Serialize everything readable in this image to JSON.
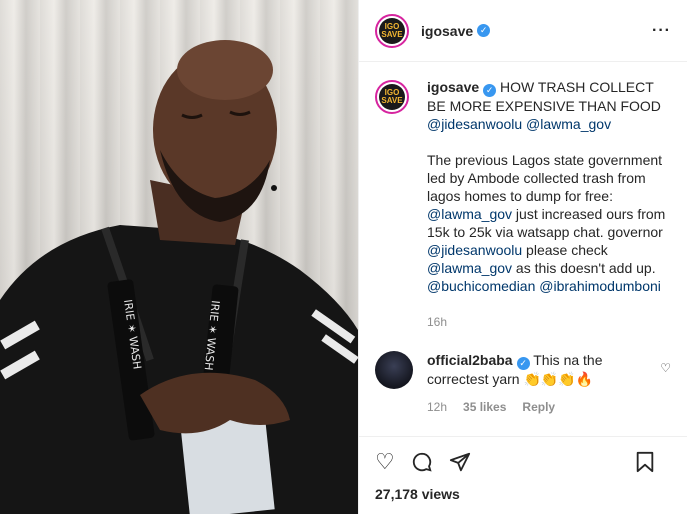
{
  "post": {
    "username": "igosave",
    "avatar_text": "IGO SAVE",
    "caption_title": "HOW TRASH COLLECT BE MORE EXPENSIVE THAN FOOD",
    "caption_mentions": "@jidesanwoolu @lawma_gov",
    "caption_p2_a": "The previous Lagos state government led by Ambode collected trash from lagos homes to dump for free: ",
    "caption_p2_link1": "@lawma_gov",
    "caption_p2_b": " just increased ours from 15k to 25k via watsapp chat. governor ",
    "caption_p2_link2": "@jidesanwoolu",
    "caption_p2_c": " please check ",
    "caption_p2_link3": "@lawma_gov",
    "caption_p2_d": " as this doesn't add up. ",
    "caption_p2_link4": "@buchicomedian",
    "caption_p2_space": " ",
    "caption_p2_link5": "@ibrahimodumboni",
    "time": "16h",
    "views": "27,178 views"
  },
  "comment": {
    "username": "official2baba",
    "text": "This na the correctest yarn 👏👏👏🔥",
    "time": "12h",
    "likes": "35 likes",
    "reply": "Reply"
  },
  "icons": {
    "more": "more-icon",
    "verified": "verified-icon",
    "like": "heart-icon",
    "comment": "comment-icon",
    "share": "share-icon",
    "save": "bookmark-icon",
    "comment_like": "heart-small-icon"
  },
  "colors": {
    "verified": "#3897f0",
    "link": "#00376b",
    "muted": "#8e8e8e"
  }
}
